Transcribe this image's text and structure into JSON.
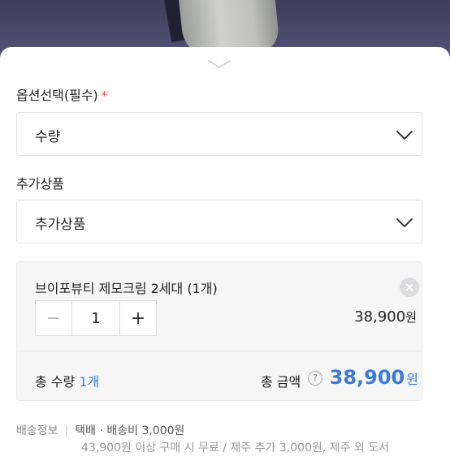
{
  "option_select": {
    "label": "옵션선택(필수)",
    "required_mark": "*",
    "value": "수량"
  },
  "addon_select": {
    "label": "추가상품",
    "value": "추가상품"
  },
  "selected_item": {
    "name": "브이포뷰티 제모크림 2세대 (1개)",
    "quantity": "1",
    "price": "38,900",
    "price_unit": "원",
    "minus": "−",
    "plus": "+"
  },
  "totals": {
    "qty_label": "총 수량",
    "qty_value": "1개",
    "amount_label": "총 금액",
    "help": "?",
    "amount": "38,900",
    "amount_unit": "원"
  },
  "shipping": {
    "label": "배송정보",
    "info": "택배 · 배송비 3,000원",
    "detail": "43,900원 이상 구매 시 무료 / 제주 추가 3,000원, 제주 외 도서"
  },
  "colors": {
    "accent": "#3d7ad6",
    "required": "#e5484d"
  }
}
